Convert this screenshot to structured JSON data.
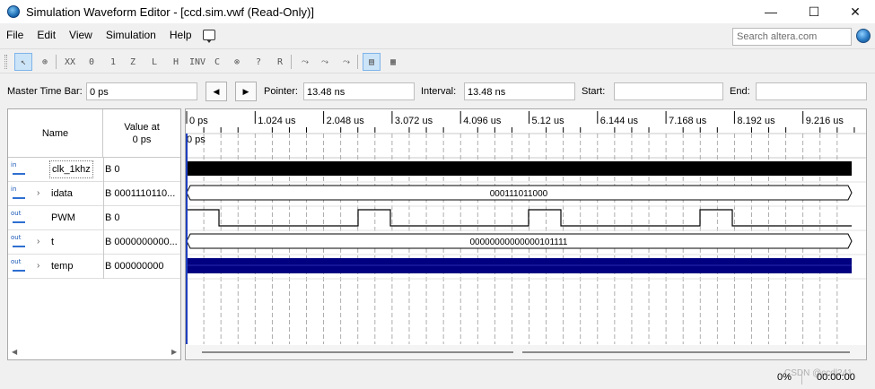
{
  "window": {
    "title": "Simulation Waveform Editor - [ccd.sim.vwf (Read-Only)]",
    "minimize_glyph": "—",
    "maximize_glyph": "☐",
    "close_glyph": "✕"
  },
  "menu": {
    "items": [
      "File",
      "Edit",
      "View",
      "Simulation",
      "Help"
    ],
    "search_placeholder": "Search altera.com"
  },
  "toolbar": {
    "buttons": [
      {
        "icon": "pointer-icon",
        "glyph": "↖",
        "active": true
      },
      {
        "icon": "zoom-icon",
        "glyph": "⊕"
      },
      {
        "icon": "uninitialized-icon",
        "glyph": "XX"
      },
      {
        "icon": "force-low-icon",
        "glyph": "0"
      },
      {
        "icon": "force-high-icon",
        "glyph": "1"
      },
      {
        "icon": "high-impedance-icon",
        "glyph": "Z"
      },
      {
        "icon": "weak-low-icon",
        "glyph": "L"
      },
      {
        "icon": "weak-high-icon",
        "glyph": "H"
      },
      {
        "icon": "invert-icon",
        "glyph": "INV"
      },
      {
        "icon": "count-value-icon",
        "glyph": "C"
      },
      {
        "icon": "clock-icon",
        "glyph": "⊗"
      },
      {
        "icon": "arbitrary-value-icon",
        "glyph": "?"
      },
      {
        "icon": "random-value-icon",
        "glyph": "R"
      },
      {
        "icon": "snap-to-grid-icon",
        "glyph": "⤳"
      },
      {
        "icon": "grid-settings-icon",
        "glyph": "⤳"
      },
      {
        "icon": "run-simulation-icon",
        "glyph": "⤳"
      },
      {
        "icon": "functional-sim-icon",
        "glyph": "▤",
        "active": true
      },
      {
        "icon": "timing-sim-icon",
        "glyph": "▦"
      }
    ]
  },
  "timebar": {
    "master_label": "Master Time Bar:",
    "master_value": "0 ps",
    "pointer_label": "Pointer:",
    "pointer_value": "13.48 ns",
    "interval_label": "Interval:",
    "interval_value": "13.48 ns",
    "start_label": "Start:",
    "start_value": "",
    "end_label": "End:",
    "end_value": ""
  },
  "names_panel": {
    "col_name": "Name",
    "col_value_line1": "Value at",
    "col_value_line2": "0 ps",
    "signals": [
      {
        "dir": "in",
        "name": "clk_1khz",
        "value": "B 0",
        "expandable": false,
        "selected": true
      },
      {
        "dir": "in",
        "name": "idata",
        "value": "B 0001110110...",
        "expandable": true
      },
      {
        "dir": "out",
        "name": "PWM",
        "value": "B 0",
        "expandable": false
      },
      {
        "dir": "out",
        "name": "t",
        "value": "B 0000000000...",
        "expandable": true
      },
      {
        "dir": "out",
        "name": "temp",
        "value": "B 000000000",
        "expandable": true
      }
    ]
  },
  "waveform": {
    "time_ticks": [
      "0 ps",
      "1.024 us",
      "2.048 us",
      "3.072 us",
      "4.096 us",
      "5.12 us",
      "6.144 us",
      "7.168 us",
      "8.192 us",
      "9.216 us"
    ],
    "master_marker_label": "0 ps",
    "idata_bus_value": "000111011000",
    "t_bus_value": "00000000000000101111",
    "colors": {
      "clock_fill": "#000000",
      "temp_fill": "#000080",
      "grid": "#9a9a9a",
      "master_bar": "#1f3fbf"
    }
  },
  "status": {
    "progress": "0%",
    "elapsed": "00:00:00",
    "watermark": "CSDN @ccdl241"
  }
}
